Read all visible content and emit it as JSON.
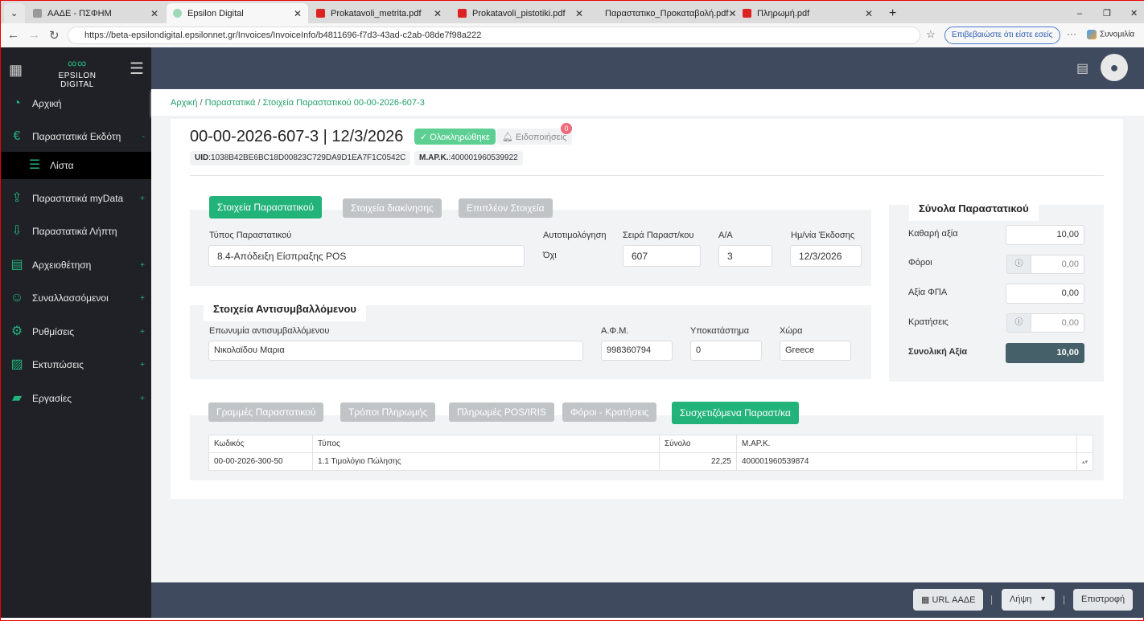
{
  "browser": {
    "tabs": [
      {
        "label": "ΑΑΔΕ - ΠΣΦΗΜ"
      },
      {
        "label": "Epsilon Digital"
      },
      {
        "label": "Prokatavoli_metrita.pdf"
      },
      {
        "label": "Prokatavoli_pistotiki.pdf"
      },
      {
        "label": "Παραστατικο_Προκαταβολή.pdf"
      },
      {
        "label": "Πληρωμή.pdf"
      }
    ],
    "url": "https://beta-epsilondigital.epsilonnet.gr/Invoices/InvoiceInfo/b4811696-f7d3-43ad-c2ab-08de7f98a222",
    "profile_label": "Επιβεβαιώστε ότι είστε εσείς",
    "copilot_label": "Συνομιλία"
  },
  "sidebar": {
    "logo": "EPSILON DIGITAL",
    "items": [
      {
        "label": "Αρχική"
      },
      {
        "label": "Παραστατικά Εκδότη",
        "toggle": "-"
      },
      {
        "label": "Λίστα"
      },
      {
        "label": "Παραστατικά myData",
        "toggle": "+"
      },
      {
        "label": "Παραστατικά Λήπτη"
      },
      {
        "label": "Αρχειοθέτηση",
        "toggle": "+"
      },
      {
        "label": "Συναλλασσόμενοι",
        "toggle": "+"
      },
      {
        "label": "Ρυθμίσεις",
        "toggle": "+"
      },
      {
        "label": "Εκτυπώσεις",
        "toggle": "+"
      },
      {
        "label": "Εργασίες",
        "toggle": "+"
      }
    ]
  },
  "breadcrumb": [
    "Αρχική",
    "/",
    "Παραστατικά",
    "/",
    "Στοιχεία Παραστατικού 00-00-2026-607-3"
  ],
  "header": {
    "title": "00-00-2026-607-3 | 12/3/2026",
    "status": "✓ Ολοκληρώθηκε",
    "notifications": "Ειδοποιήσεις",
    "notif_count": "0",
    "uid_label": "UID",
    "uid": ":1038B42BE6BC18D00823C729DA9D1EA7F1C0542C",
    "mark_label": "Μ.ΑΡ.Κ.",
    "mark": ":400001960539922"
  },
  "doc_tabs": [
    "Στοιχεία Παραστατικού",
    "Στοιχεία διακίνησης",
    "Επιπλέον Στοιχεία"
  ],
  "doc": {
    "type_label": "Τύπος Παραστατικού",
    "type": "8.4-Απόδειξη Είσπραξης POS",
    "self_label": "Αυτοτιμολόγηση",
    "self": "Όχι",
    "series_label": "Σειρά Παραστ/κου",
    "series": "607",
    "aa_label": "Α/Α",
    "aa": "3",
    "date_label": "Ημ/νία Έκδοσης",
    "date": "12/3/2026"
  },
  "party": {
    "heading": "Στοιχεία Αντισυμβαλλόμενου",
    "name_label": "Επωνυμία αντισυμβαλλόμενου",
    "name": "Νικολαϊδου Μαρια",
    "afm_label": "Α.Φ.Μ.",
    "afm": "998360794",
    "branch_label": "Υποκατάστημα",
    "branch": "0",
    "country_label": "Χώρα",
    "country": "Greece"
  },
  "totals": {
    "heading": "Σύνολα Παραστατικού",
    "net_label": "Καθαρή αξία",
    "net": "10,00",
    "taxes_label": "Φόροι",
    "taxes": "0,00",
    "vat_label": "Αξία ΦΠΑ",
    "vat": "0,00",
    "withheld_label": "Κρατήσεις",
    "withheld": "0,00",
    "total_label": "Συνολική Αξία",
    "total": "10,00"
  },
  "lower_tabs": [
    "Γραμμές Παραστατικού",
    "Τρόποι Πληρωμής",
    "Πληρωμές POS/IRIS",
    "Φόροι - Κρατήσεις",
    "Συσχετιζόμενα Παραστ/κα"
  ],
  "related": {
    "columns": [
      "Κωδικός",
      "Τύπος",
      "Σύνολο",
      "Μ.ΑΡ.Κ."
    ],
    "rows": [
      [
        "00-00-2026-300-50",
        "1.1 Τιμολόγιο Πώλησης",
        "22,25",
        "400001960539874"
      ]
    ]
  },
  "footer": {
    "url_aade": "URL ΑΑΔΕ",
    "download": "Λήψη",
    "back": "Επιστροφή"
  }
}
